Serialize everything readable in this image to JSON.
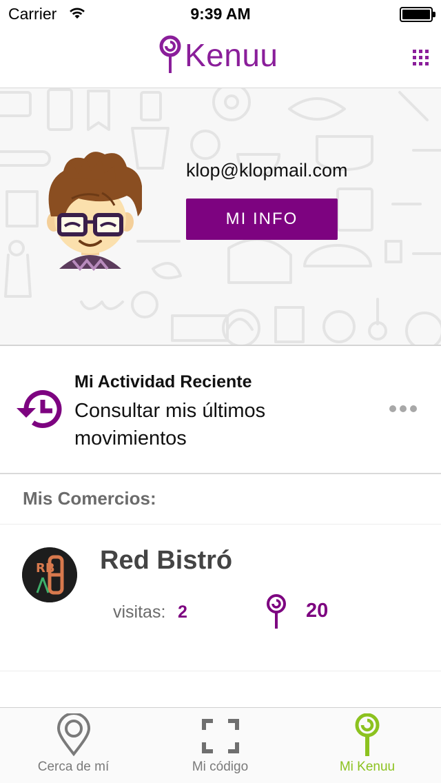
{
  "status_bar": {
    "carrier": "Carrier",
    "time": "9:39 AM",
    "icons": [
      "wifi-icon",
      "battery-icon"
    ]
  },
  "nav": {
    "logo_text": "Kenuu",
    "logo_icon": "lollipop-icon",
    "menu_icon": "grid-menu-icon"
  },
  "profile": {
    "email": "klop@klopmail.com",
    "info_button": "MI INFO",
    "avatar": "avatar-icon"
  },
  "activity": {
    "icon": "history-icon",
    "title": "Mi Actividad Reciente",
    "description": "Consultar mis últimos movimientos",
    "more_icon": "more-dots-icon"
  },
  "businesses": {
    "section_title": "Mis Comercios:",
    "items": [
      {
        "name": "Red Bistró",
        "logo_letters": "RB",
        "visits_label": "visitas:",
        "visits": "2",
        "points": "20"
      }
    ]
  },
  "tab_bar": {
    "tabs": [
      {
        "label": "Cerca de mí",
        "icon": "location-pin-icon",
        "active": false
      },
      {
        "label": "Mi código",
        "icon": "scan-frame-icon",
        "active": false
      },
      {
        "label": "Mi Kenuu",
        "icon": "lollipop-icon",
        "active": true
      }
    ]
  },
  "colors": {
    "brand_purple": "#7d0380",
    "active_tab_green": "#8cc21f",
    "text_gray": "#6b6b6b"
  }
}
